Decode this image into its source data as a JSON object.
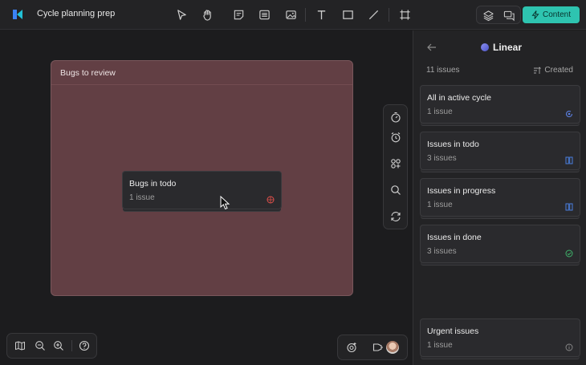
{
  "app": {
    "title": "Cycle planning prep"
  },
  "toolbar": {
    "tools": [
      "select-tool",
      "hand-tool",
      "sticky-note-tool",
      "list-tool",
      "image-tool",
      "text-tool",
      "rectangle-tool",
      "line-tool",
      "frame-tool"
    ],
    "content_label": "Content",
    "accent_color": "#2ec4b0"
  },
  "canvas": {
    "frame": {
      "title": "Bugs to review",
      "color": "#623f44"
    },
    "card": {
      "title": "Bugs in todo",
      "subtitle": "1 issue",
      "icon": "bug-icon",
      "icon_color": "#e0504a"
    }
  },
  "side_panel": {
    "title": "Linear",
    "count": "11 issues",
    "sort_label": "Created",
    "items": [
      {
        "title": "All in active cycle",
        "subtitle": "1 issue",
        "icon": "cycle-icon",
        "icon_color": "#5b7fe0"
      },
      {
        "title": "Issues in todo",
        "subtitle": "3 issues",
        "icon": "board-icon",
        "icon_color": "#4a7fe0"
      },
      {
        "title": "Issues in progress",
        "subtitle": "1 issue",
        "icon": "board-icon",
        "icon_color": "#4a7fe0"
      },
      {
        "title": "Issues in done",
        "subtitle": "3 issues",
        "icon": "check-circle-icon",
        "icon_color": "#3fb36b"
      },
      {
        "title": "Urgent issues",
        "subtitle": "1 issue",
        "icon": "info-icon",
        "icon_color": "#8a8a8a"
      }
    ]
  }
}
